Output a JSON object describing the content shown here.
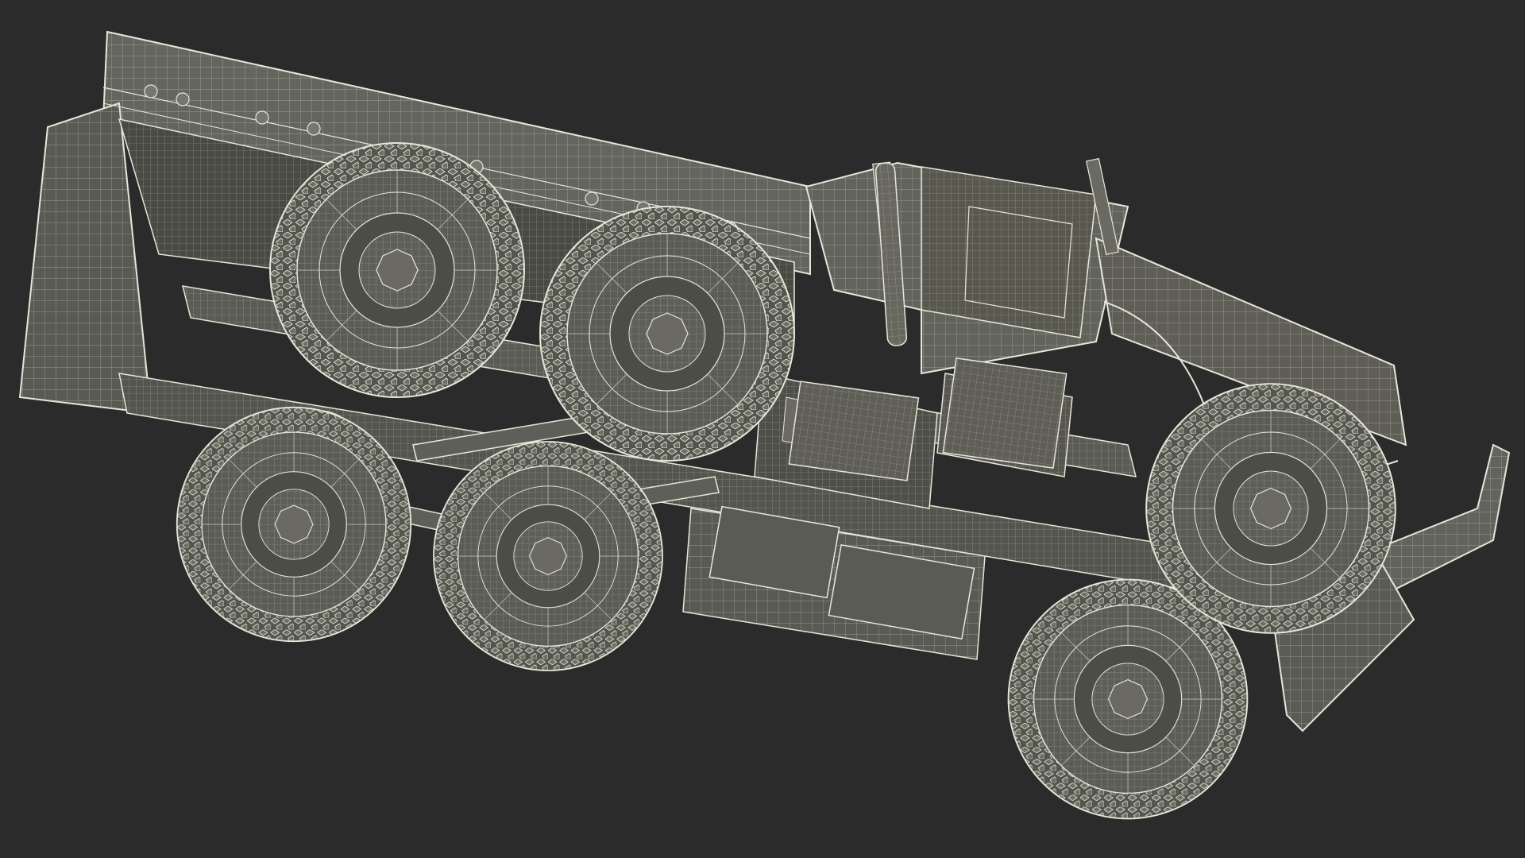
{
  "scene": {
    "subject": "wireframe-render-military-truck-underside",
    "colors": {
      "background": "#2b2b2b",
      "body": "#5c5c57",
      "body_dark": "#45453f",
      "body_light": "#74746c",
      "wire": "#e6e6d8",
      "tire": "#5a5a55",
      "tread": "#d8d8c8"
    }
  }
}
